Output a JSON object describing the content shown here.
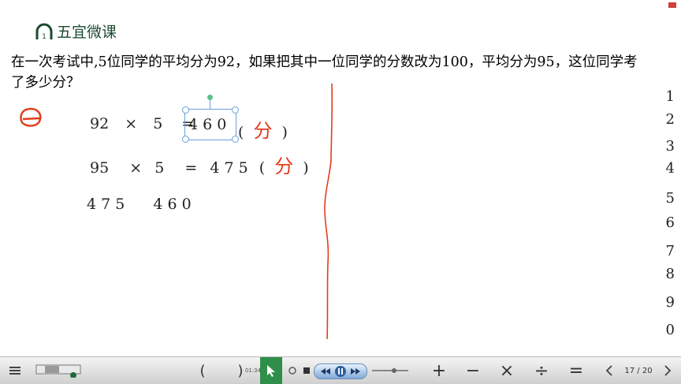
{
  "logo": {
    "text": "五宜微课"
  },
  "question": {
    "text": "在一次考试中,5位同学的平均分为92，如果把其中一位同学的分数改为100，平均分为95，这位同学考了多少分？"
  },
  "work": {
    "row1": {
      "a": "92",
      "op": "×",
      "b": "5",
      "eq": "=",
      "result": "4 6 0",
      "lp": "(",
      "unit": "分",
      "rp": ")"
    },
    "row2": {
      "a": "95",
      "op": "×",
      "b": "5",
      "eq": "=",
      "result": "4 7 5",
      "lp": "(",
      "unit": "分",
      "rp": ")"
    },
    "row3": {
      "left": "4 7 5",
      "right": "4 6 0"
    }
  },
  "side_numbers": [
    "1",
    "2",
    "3",
    "4",
    "5",
    "6",
    "7",
    "8",
    "9",
    "0"
  ],
  "toolbar": {
    "parens": [
      "(",
      ")"
    ],
    "time": "01:34",
    "operators": [
      "+",
      "−",
      "×",
      "÷",
      "="
    ],
    "page": "17 / 20",
    "prev_icon": "chevron-left-icon",
    "next_icon": "chevron-right-icon"
  },
  "colors": {
    "ink_red": "#e33c1c",
    "logo_green": "#1c4b2f",
    "selection_blue": "#6a9fd8"
  }
}
